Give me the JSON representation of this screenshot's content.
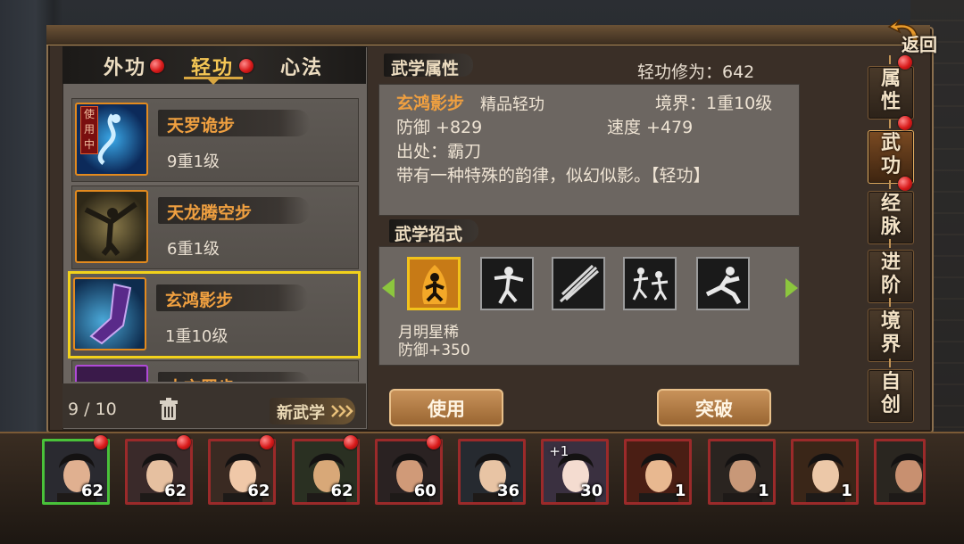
{
  "tabs": [
    {
      "label": "外功",
      "active": false,
      "badge": true
    },
    {
      "label": "轻功",
      "active": true,
      "badge": true
    },
    {
      "label": "心法",
      "active": false,
      "badge": false
    }
  ],
  "skill_list": [
    {
      "name": "天罗诡步",
      "level": "9重1级",
      "tag": "使用中",
      "selected": false
    },
    {
      "name": "天龙腾空步",
      "level": "6重1级",
      "selected": false
    },
    {
      "name": "玄鸿影步",
      "level": "1重10级",
      "selected": true
    },
    {
      "name": "太玄罡步",
      "level": "",
      "selected": false
    }
  ],
  "list_footer": {
    "count": "9 / 10",
    "new_skill": "新武学"
  },
  "attributes": {
    "title": "武学属性",
    "cultivation": "轻功修为：642",
    "skill_name": "玄鸿影步",
    "skill_grade": "精品轻功",
    "realm": "境界：1重10级",
    "defense": "防御 +829",
    "speed": "速度 +479",
    "source": "出处：霸刀",
    "description": "带有一种特殊的韵律，似幻似影。【轻功】"
  },
  "moves": {
    "title": "武学招式",
    "items": [
      "月明星稀",
      "move-2",
      "move-3",
      "move-4",
      "move-5"
    ],
    "selected_name": "月明星稀",
    "selected_bonus": "防御+350"
  },
  "buttons": {
    "use": "使用",
    "breakthrough": "突破"
  },
  "side_tabs": [
    {
      "label": "属性",
      "active": false,
      "badge": true
    },
    {
      "label": "武功",
      "active": true,
      "badge": true
    },
    {
      "label": "经脉",
      "active": false,
      "badge": true
    },
    {
      "label": "进阶",
      "active": false,
      "badge": false
    },
    {
      "label": "境界",
      "active": false,
      "badge": false
    },
    {
      "label": "自创",
      "active": false,
      "badge": false
    }
  ],
  "return_label": "返回",
  "heroes": [
    {
      "level": "62",
      "selected": true,
      "badge": true
    },
    {
      "level": "62",
      "selected": false,
      "badge": true
    },
    {
      "level": "62",
      "selected": false,
      "badge": true
    },
    {
      "level": "62",
      "selected": false,
      "badge": true
    },
    {
      "level": "60",
      "selected": false,
      "badge": true
    },
    {
      "level": "36",
      "selected": false,
      "badge": false
    },
    {
      "level": "30",
      "selected": false,
      "badge": false,
      "plus": "+1"
    },
    {
      "level": "1",
      "selected": false,
      "badge": false
    },
    {
      "level": "1",
      "selected": false,
      "badge": false
    },
    {
      "level": "1",
      "selected": false,
      "badge": false
    },
    {
      "level": "",
      "selected": false,
      "badge": false
    }
  ],
  "colors": {
    "accent": "#f0a040",
    "select": "#f2d21b",
    "badge": "#d81a1a",
    "hero_selected": "#49c23a"
  }
}
